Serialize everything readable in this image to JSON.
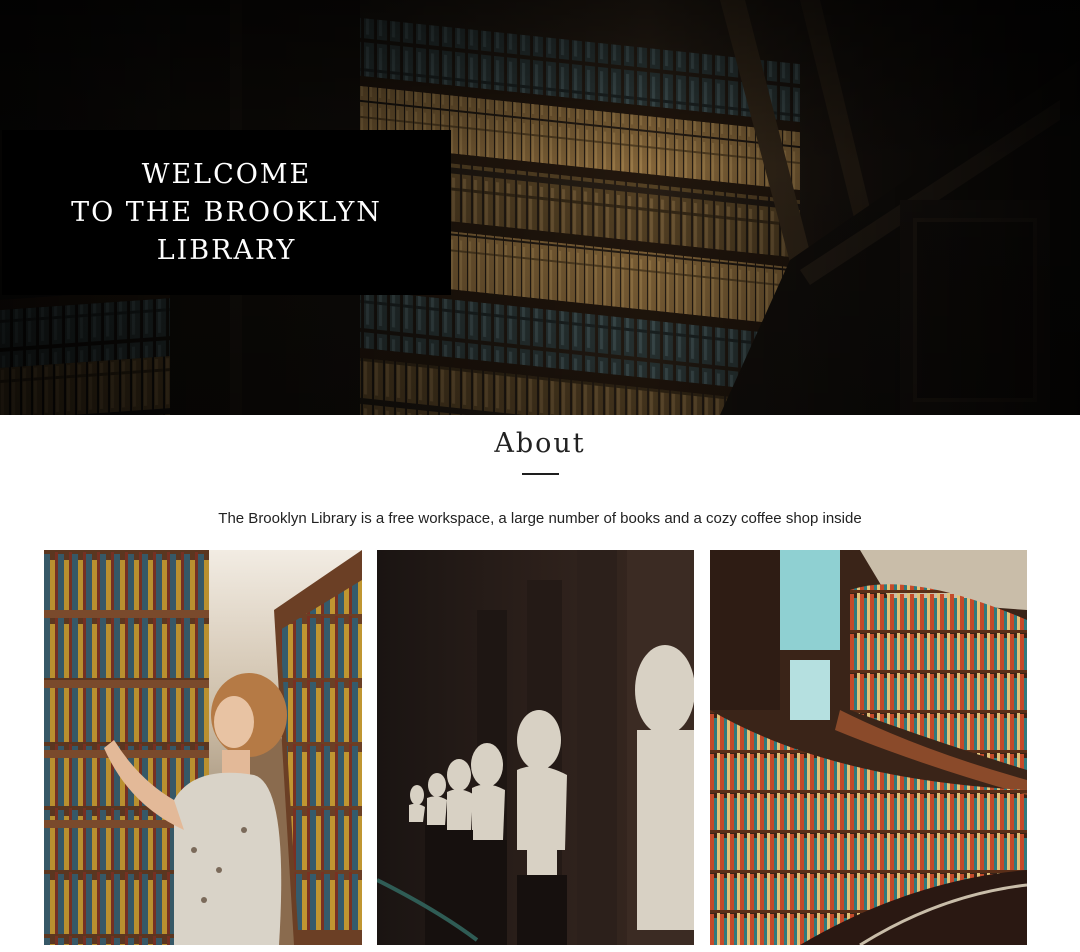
{
  "hero": {
    "title_lines": [
      "WELCOME",
      "TO THE BROOKLYN",
      "LIBRARY"
    ],
    "image": "library-bookshelves-dark-photo"
  },
  "about": {
    "title": "About",
    "description": "The Brooklyn Library is a free workspace, a large number of books and a cozy coffee shop inside"
  },
  "gallery": [
    {
      "image": "woman-browsing-bookshelf-photo"
    },
    {
      "image": "marble-busts-corridor-photo"
    },
    {
      "image": "curved-library-shelves-photo"
    }
  ]
}
